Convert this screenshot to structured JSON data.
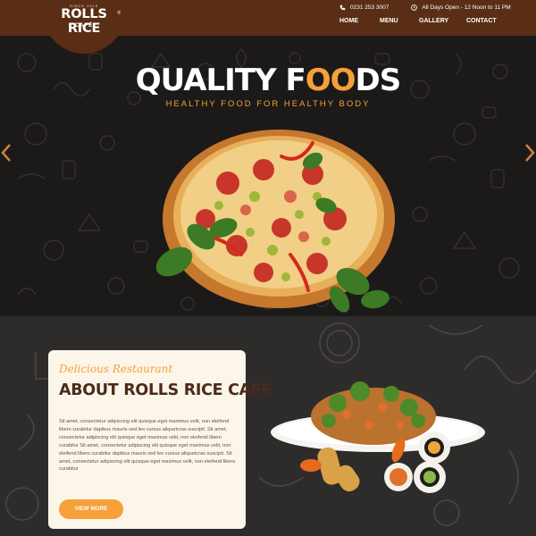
{
  "brand": {
    "tagline_small": "SINCE 2015",
    "name": "ROLLS RICE",
    "sub": "CAFÉ",
    "reg": "®"
  },
  "contact": {
    "phone": "0231 253 3007",
    "hours": "All Days Open - 12 Noon to 11 PM"
  },
  "nav": [
    "HOME",
    "MENU",
    "GALLERY",
    "CONTACT"
  ],
  "hero": {
    "title_part1": "QUALITY F",
    "title_highlight": "OO",
    "title_part2": "DS",
    "subtitle": "HEALTHY FOOD FOR HEALTHY BODY"
  },
  "about": {
    "script_title": "Delicious Restaurant",
    "heading": "ABOUT ROLLS RICE CAFE",
    "body": "Sit amet, consectetur adipiscing elit quisque eget maximus velit, non eleifend libero curabitur dapibus mauris sed leo cursus aliquetcras suscipit. Sit amet, consectetur adipiscing elit quisque eget maximus velit, non eleifend libero curabitur Sit amet, consectetur adipiscing elit quisque eget maximus velit, non eleifend libero curabitur dapibus mauris sed leo cursus aliquetcras suscipit. Sit amet, consectetur adipiscing elit quisque eget maximus velit, non eleifend libero curabitur",
    "button": "VIEW MORE"
  },
  "colors": {
    "header": "#5a2e15",
    "accent": "#f5a038",
    "hero_bg": "#1c1a19",
    "about_bg": "#2e2c2b",
    "card_bg": "#fcf5ea",
    "heading": "#4a2b1a"
  },
  "icons": [
    "phone-icon",
    "clock-icon",
    "arrow-left-icon",
    "arrow-right-icon"
  ]
}
